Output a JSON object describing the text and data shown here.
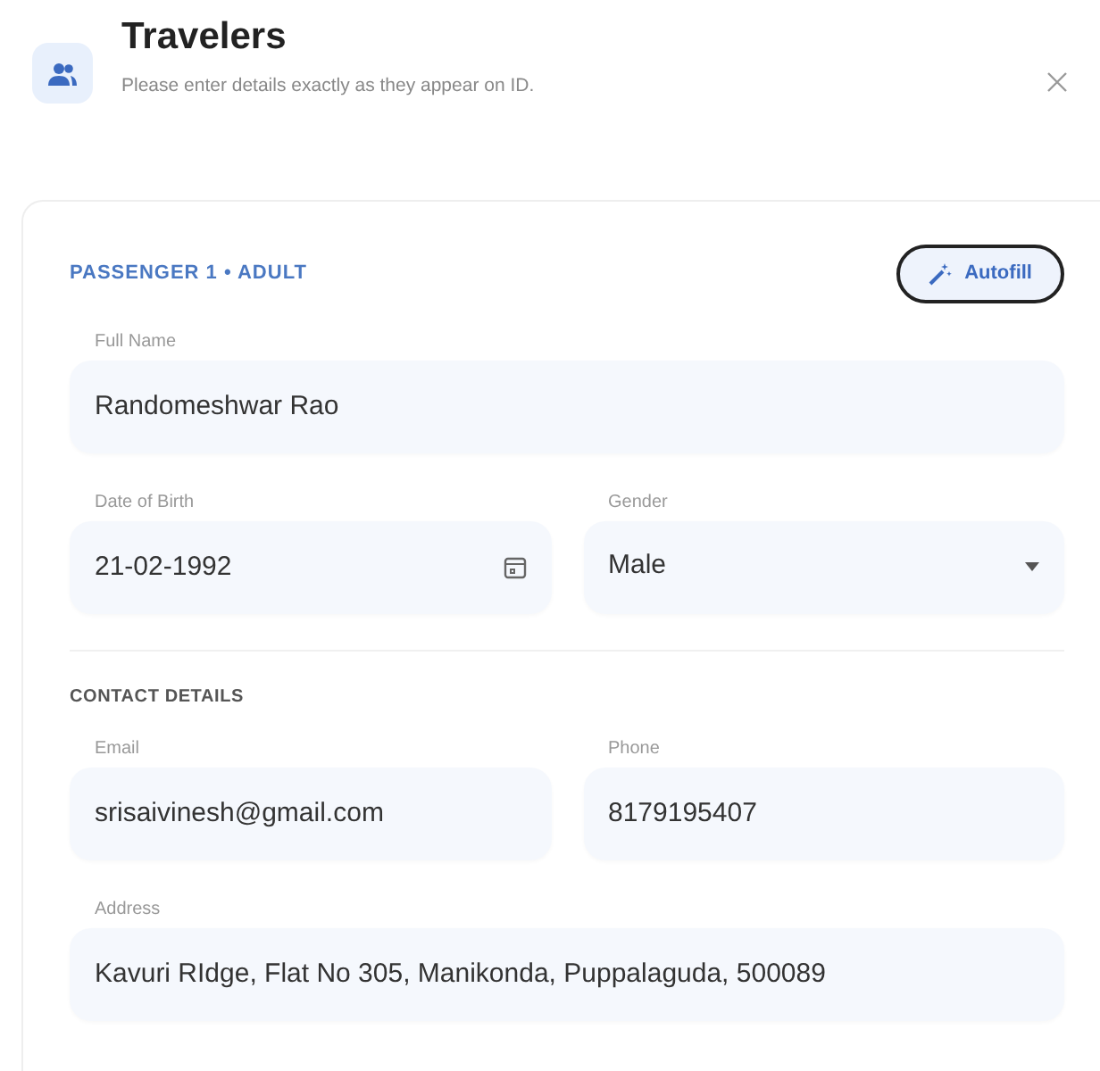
{
  "header": {
    "title": "Travelers",
    "subtitle": "Please enter details exactly as they appear on ID."
  },
  "passenger": {
    "heading": "PASSENGER 1 • ADULT",
    "autofill": "Autofill"
  },
  "field_rows": [
    [
      {
        "label": "Full Name",
        "value": "Randomeshwar Rao",
        "kind": "text"
      }
    ],
    [
      {
        "label": "Date of Birth",
        "value": "21-02-1992",
        "kind": "date"
      },
      {
        "label": "Gender",
        "value": "Male",
        "kind": "select"
      }
    ]
  ],
  "contact": {
    "heading": "CONTACT DETAILS"
  },
  "contact_rows": [
    [
      {
        "label": "Email",
        "value": "srisaivinesh@gmail.com"
      },
      {
        "label": "Phone",
        "value": "8179195407"
      }
    ],
    [
      {
        "label": "Address",
        "value": "Kavuri RIdge, Flat No 305, Manikonda, Puppalaguda, 500089"
      }
    ]
  ]
}
